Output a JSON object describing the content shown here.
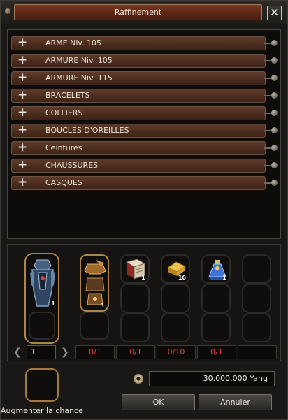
{
  "window": {
    "title": "Raffinement"
  },
  "categories": [
    "ARME Niv. 105",
    "ARMURE Niv. 105",
    "ARMURE Niv. 115",
    "BRACELETS",
    "COLLIERS",
    "BOUCLES D'OREILLES",
    "Ceintures",
    "CHAUSSURES",
    "CASQUES"
  ],
  "main_item": {
    "quantity": "1"
  },
  "materials": [
    {
      "icon": "armor-piece-icon",
      "quantity": "1",
      "count": "0/1"
    },
    {
      "icon": "book-icon",
      "quantity": "1",
      "count": "0/1"
    },
    {
      "icon": "gold-bar-icon",
      "quantity": "10",
      "count": "0/10"
    },
    {
      "icon": "potion-icon",
      "quantity": "1",
      "count": "0/1"
    }
  ],
  "page": {
    "current": "1"
  },
  "bonus": {
    "label": "Augmenter la chance"
  },
  "cost": {
    "value": "30.000.000 Yang"
  },
  "buttons": {
    "ok": "OK",
    "cancel": "Annuler"
  }
}
